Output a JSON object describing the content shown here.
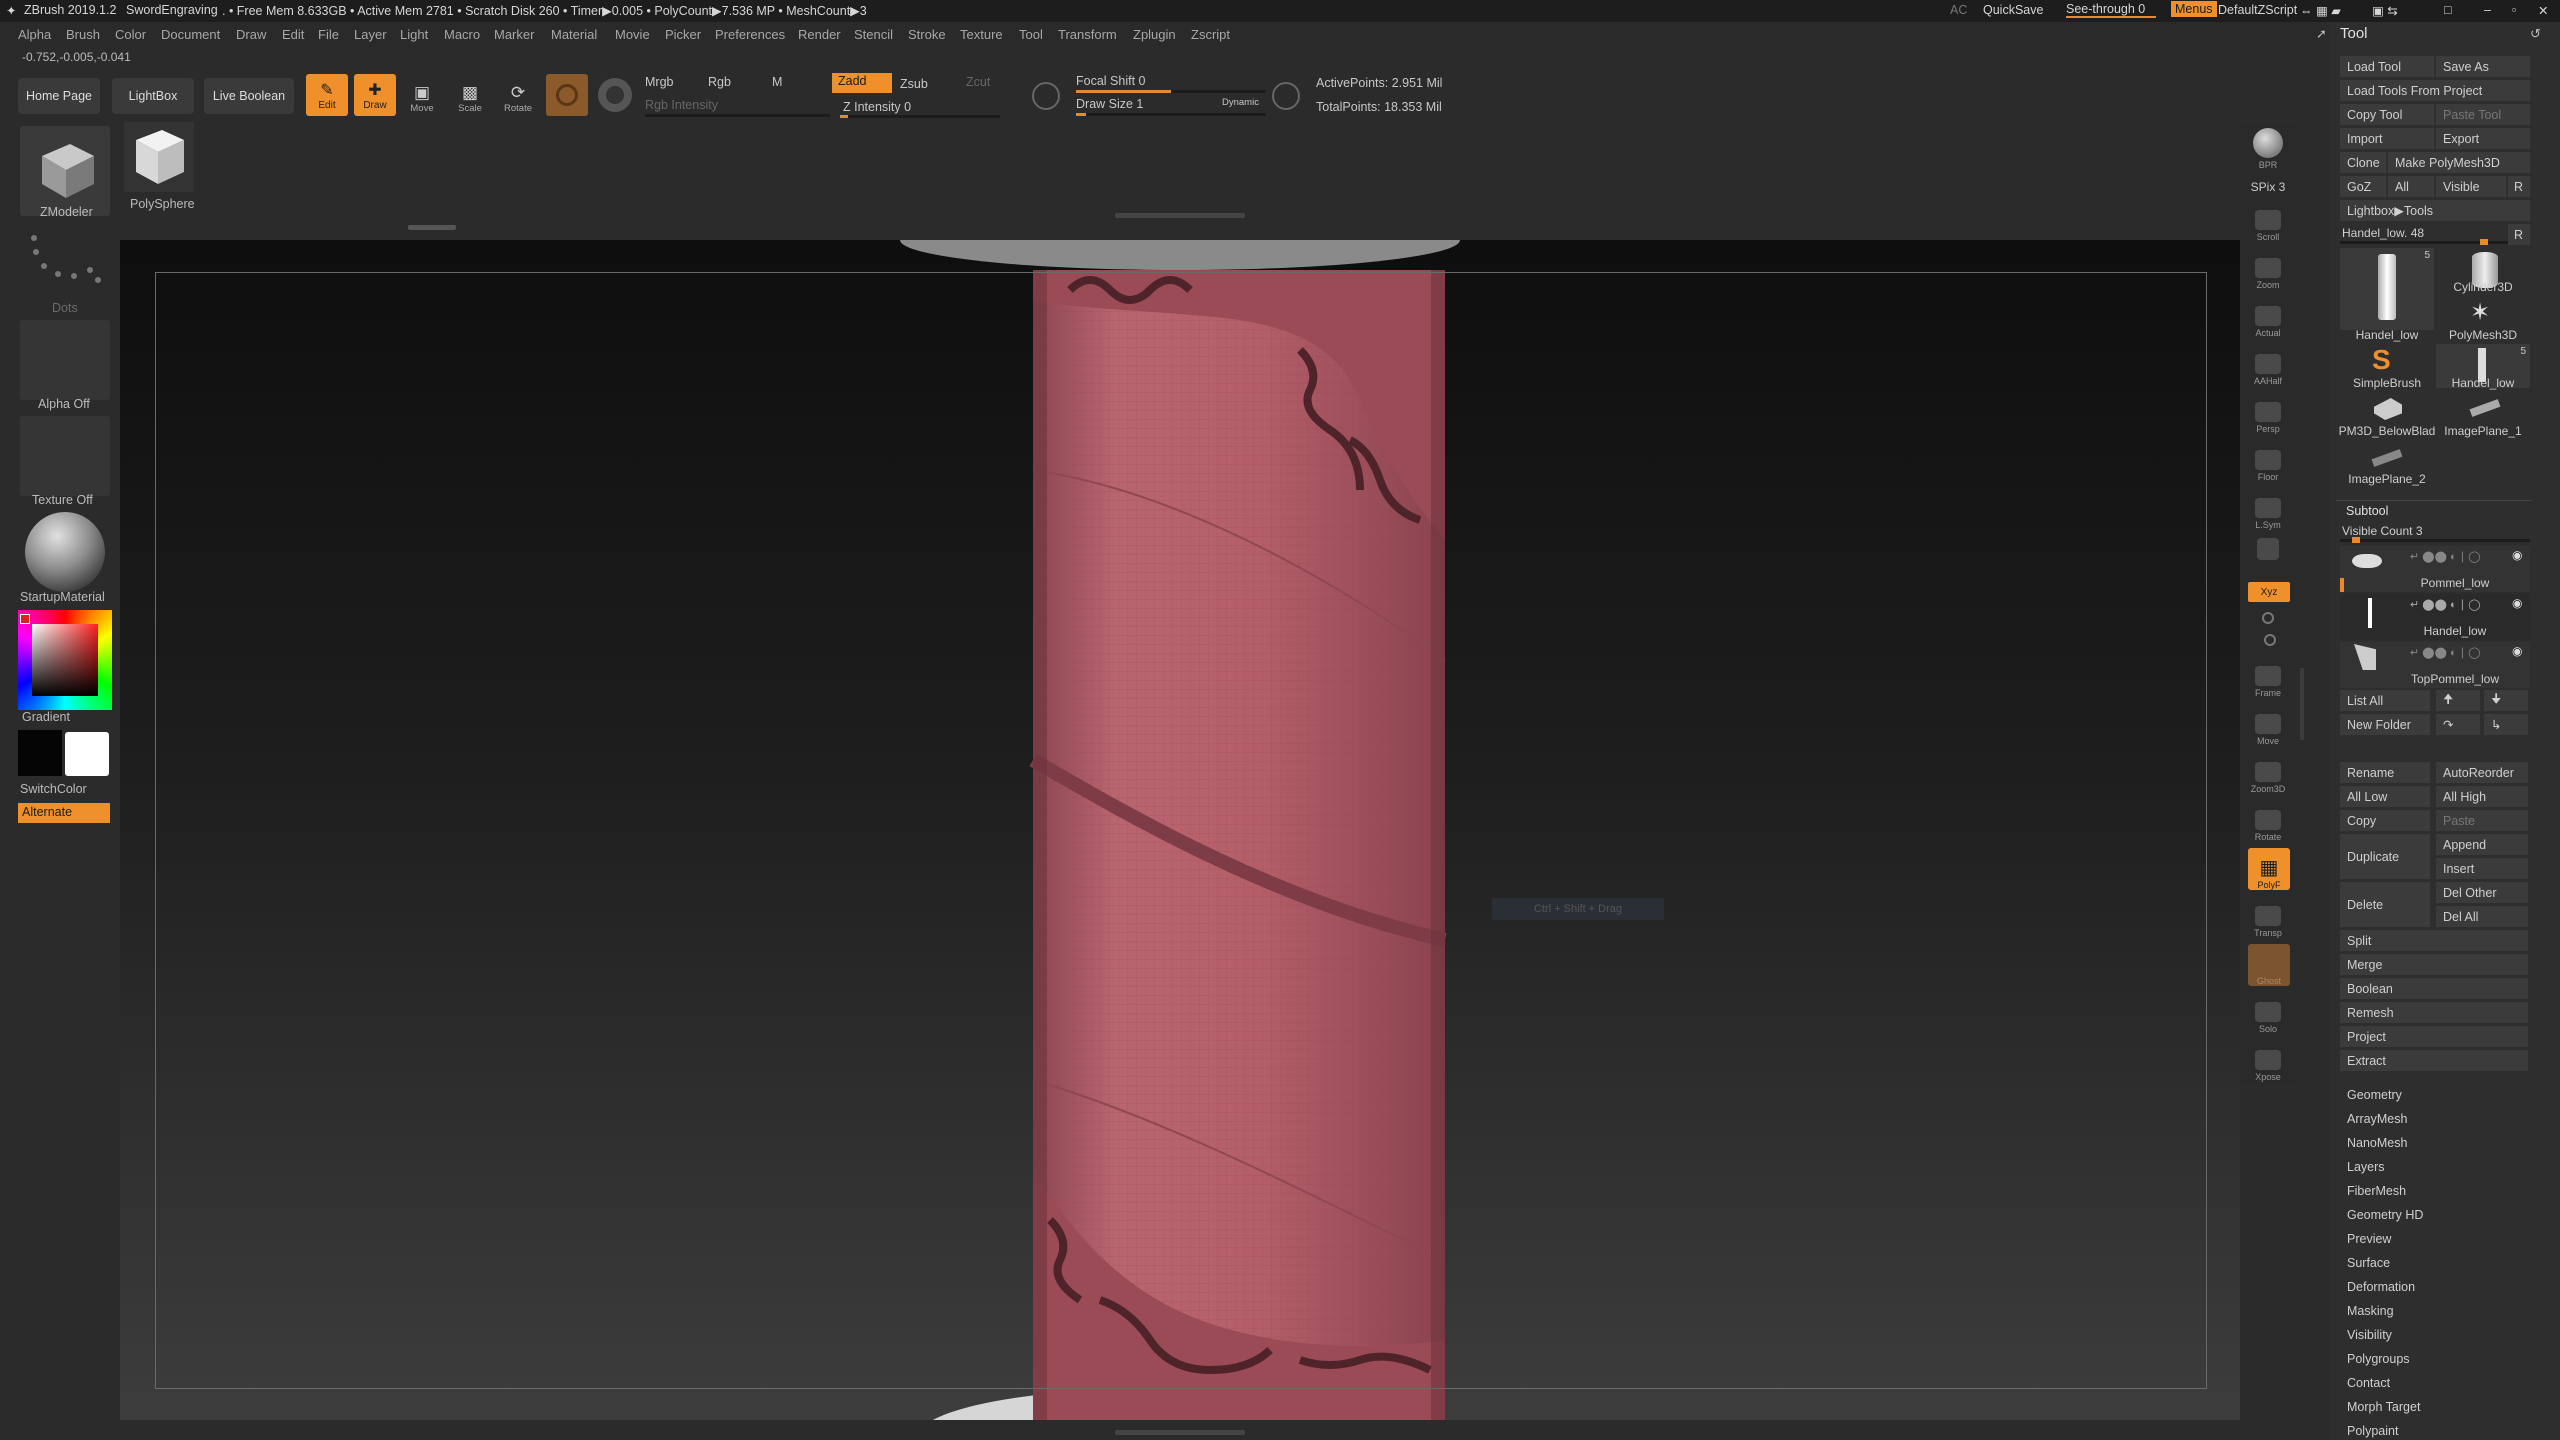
{
  "titlebar": {
    "app": "ZBrush 2019.1.2",
    "doc": "SwordEngraving",
    "stats": ". • Free Mem 8.633GB • Active Mem 2781 • Scratch Disk 260 • Timer▶0.005 • PolyCount▶7.536 MP • MeshCount▶3",
    "ac": "AC",
    "quicksave": "QuickSave",
    "seethrough": "See-through  0",
    "menus": "Menus",
    "defaultzscript": "DefaultZScript"
  },
  "menubar": [
    "Alpha",
    "Brush",
    "Color",
    "Document",
    "Draw",
    "Edit",
    "File",
    "Layer",
    "Light",
    "Macro",
    "Marker",
    "Material",
    "Movie",
    "Picker",
    "Preferences",
    "Render",
    "Stencil",
    "Stroke",
    "Texture",
    "Tool",
    "Transform",
    "Zplugin",
    "Zscript"
  ],
  "coords": "-0.752,-0.005,-0.041",
  "shelf": {
    "home": "Home Page",
    "lightbox": "LightBox",
    "liveboolean": "Live Boolean",
    "edit": "Edit",
    "draw": "Draw",
    "move": "Move",
    "scale": "Scale",
    "rotate": "Rotate",
    "mrgb": "Mrgb",
    "rgb": "Rgb",
    "m": "M",
    "zadd": "Zadd",
    "zsub": "Zsub",
    "zcut": "Zcut",
    "rgb_intensity": "Rgb Intensity",
    "z_intensity": "Z Intensity 0",
    "focal_shift": "Focal Shift 0",
    "draw_size": "Draw Size 1",
    "dynamic": "Dynamic",
    "active_points": "ActivePoints: 2.951 Mil",
    "total_points": "TotalPoints: 18.353 Mil",
    "z_intensity_level": 0.05,
    "focal_shift_level": 0.5,
    "draw_size_level": 0.05
  },
  "leftshelf": {
    "zmodeler": "ZModeler",
    "polysphere": "PolySphere",
    "dots": "Dots",
    "alpha": "Alpha Off",
    "texture": "Texture Off",
    "material": "StartupMaterial",
    "gradient": "Gradient",
    "switchcolor": "SwitchColor",
    "alternate": "Alternate"
  },
  "viewport": {
    "hint": "Ctrl + Shift + Drag"
  },
  "rightshelf": [
    "BPR",
    "SPix 3",
    "Scroll",
    "Zoom",
    "Actual",
    "AAHalf",
    "Persp",
    "Floor",
    "L.Sym",
    "Xyz",
    "Frame",
    "Move",
    "Zoom3D",
    "Rotate",
    "PolyF",
    "Transp",
    "Ghost",
    "Solo",
    "Xpose"
  ],
  "toolpanel": {
    "title": "Tool",
    "load_tool": "Load Tool",
    "save_as": "Save As",
    "load_from_project": "Load Tools From Project",
    "copy_tool": "Copy Tool",
    "paste_tool": "Paste Tool",
    "import": "Import",
    "export": "Export",
    "clone": "Clone",
    "make_polymesh": "Make PolyMesh3D",
    "goz": "GoZ",
    "all": "All",
    "visible": "Visible",
    "r": "R",
    "lightbox_tools": "Lightbox▶Tools",
    "current_tool": "Handel_low. 48",
    "tools": [
      "Handel_low",
      "Cylinder3D",
      "PolyMesh3D",
      "SimpleBrush",
      "Handel_low",
      "PM3D_BelowBlad",
      "ImagePlane_1",
      "ImagePlane_2"
    ],
    "subtool_title": "Subtool",
    "visible_count": "Visible Count 3",
    "subtools": [
      "Pommel_low",
      "Handel_low",
      "TopPommel_low"
    ],
    "list_all": "List All",
    "new_folder": "New Folder",
    "rename": "Rename",
    "autoreorder": "AutoReorder",
    "all_low": "All Low",
    "all_high": "All High",
    "copy": "Copy",
    "paste": "Paste",
    "duplicate": "Duplicate",
    "append": "Append",
    "insert": "Insert",
    "delete": "Delete",
    "del_other": "Del Other",
    "del_all": "Del All",
    "split": "Split",
    "merge": "Merge",
    "boolean": "Boolean",
    "remesh": "Remesh",
    "project": "Project",
    "extract": "Extract",
    "sections": [
      "Geometry",
      "ArrayMesh",
      "NanoMesh",
      "Layers",
      "FiberMesh",
      "Geometry HD",
      "Preview",
      "Surface",
      "Deformation",
      "Masking",
      "Visibility",
      "Polygroups",
      "Contact",
      "Morph Target",
      "Polypaint"
    ]
  },
  "colors": {
    "accent": "#f0902a",
    "mesh": "#b5606a"
  }
}
